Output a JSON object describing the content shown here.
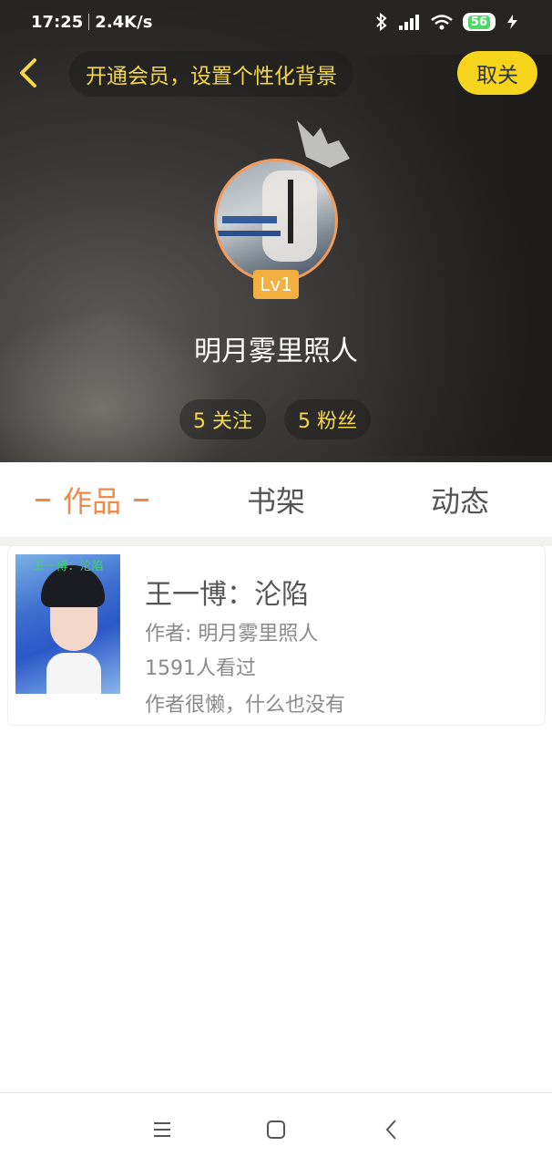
{
  "status_bar": {
    "time": "17:25",
    "net_speed": "2.4K/s",
    "battery": "56"
  },
  "header": {
    "promo_text": "开通会员，设置个性化背景",
    "unfollow_label": "取关",
    "level_badge": "Lv1",
    "username": "明月雾里照人",
    "follow_stat": "5 关注",
    "fans_stat": "5 粉丝"
  },
  "tabs": [
    {
      "label": "作品",
      "active": true
    },
    {
      "label": "书架",
      "active": false
    },
    {
      "label": "动态",
      "active": false
    }
  ],
  "works": [
    {
      "cover_caption": "王一博：沦陷",
      "title": "王一博：沦陷",
      "author": "作者: 明月雾里照人",
      "views": "1591人看过",
      "description": "作者很懒，什么也没有"
    }
  ],
  "colors": {
    "accent": "#f08a4b",
    "promo_text": "#f5d74a",
    "unfollow_bg": "#f7d51d",
    "level_badge": "#f2b040"
  },
  "icons": {
    "back": "back-arrow-icon",
    "crown": "crown-icon",
    "menu": "menu-icon",
    "home": "home-icon",
    "nav_back": "nav-back-icon"
  }
}
